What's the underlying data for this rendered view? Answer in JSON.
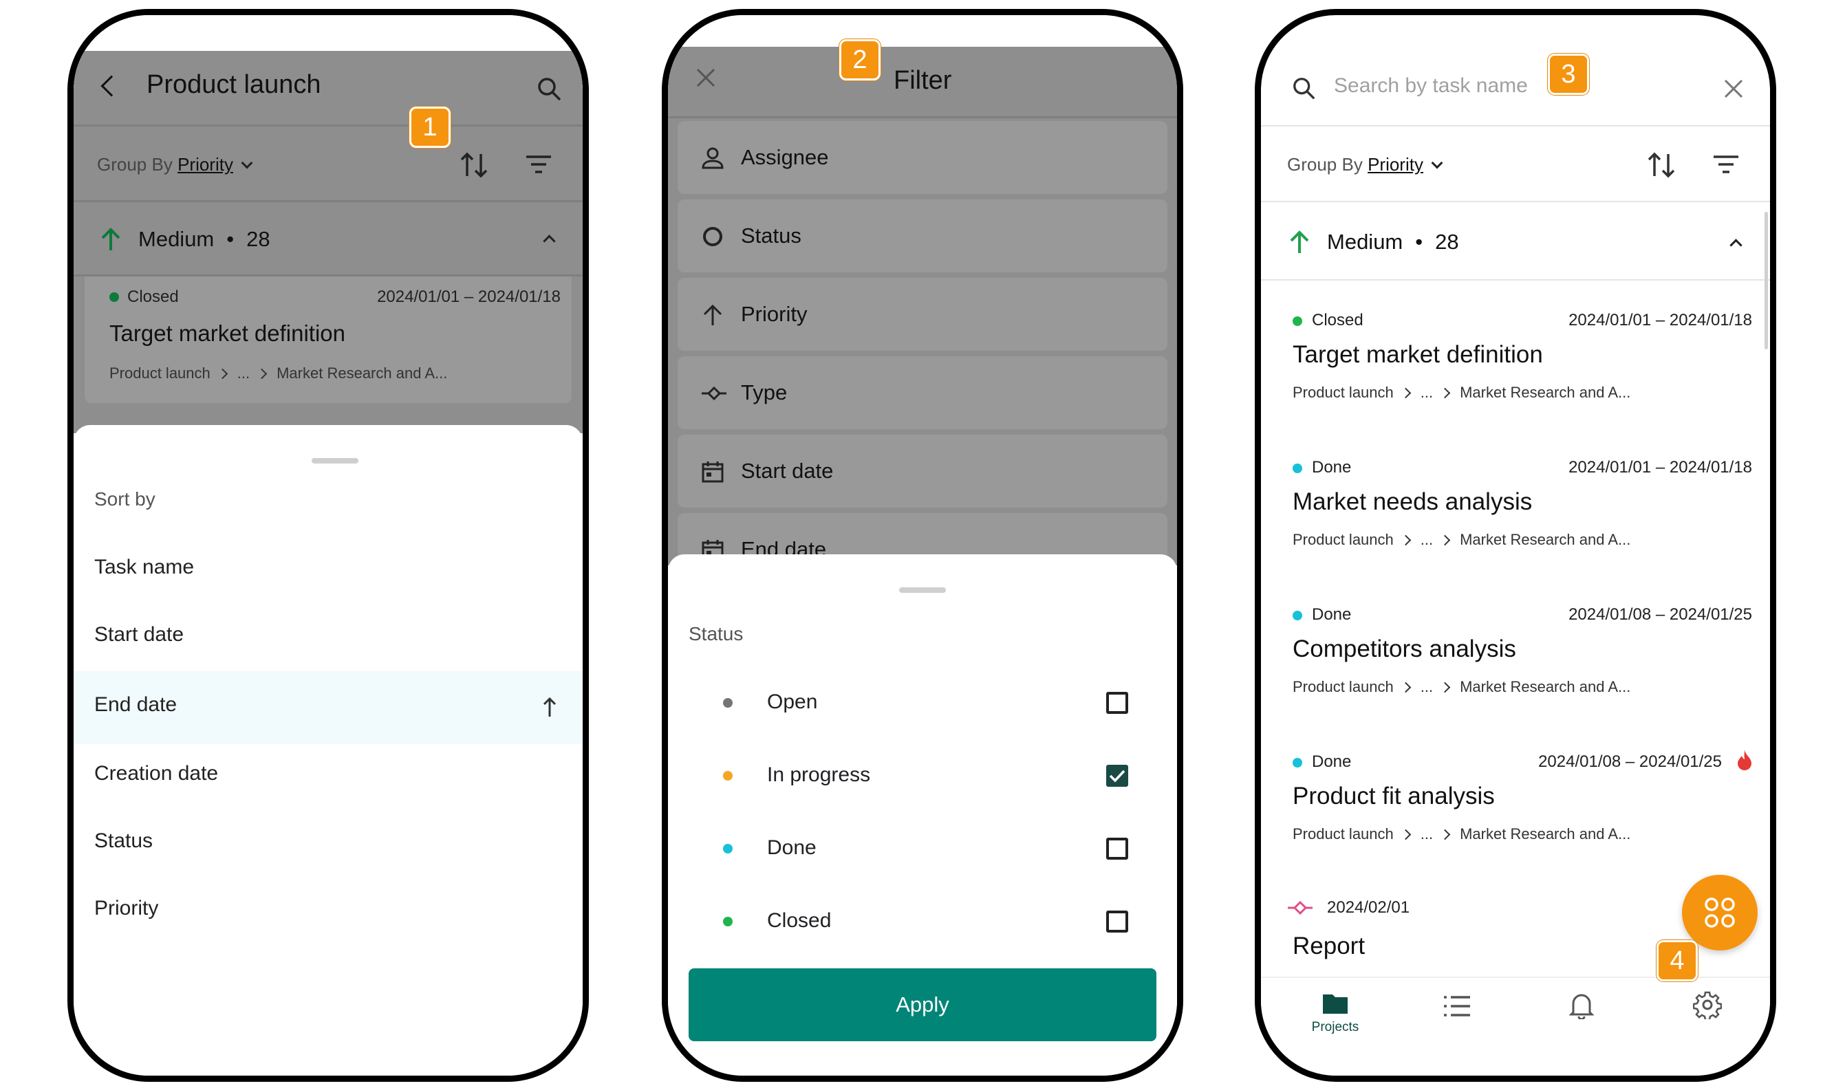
{
  "badges": [
    "1",
    "2",
    "3",
    "4"
  ],
  "screen1": {
    "title": "Product launch",
    "group_by_prefix": "Group By",
    "group_by_value": "Priority",
    "group": {
      "name": "Medium",
      "separator": "•",
      "count": "28"
    },
    "card": {
      "status": "Closed",
      "dates": "2024/01/01 – 2024/01/18",
      "title": "Target market definition",
      "breadcrumb": [
        "Product launch",
        "...",
        "Market Research and A..."
      ]
    },
    "sheet": {
      "heading": "Sort by",
      "options": [
        "Task name",
        "Start date",
        "End date",
        "Creation date",
        "Status",
        "Priority"
      ],
      "selected_index": 2,
      "selected_direction": "up-arrow-icon"
    }
  },
  "screen2": {
    "title": "Filter",
    "filters": [
      "Assignee",
      "Status",
      "Priority",
      "Type",
      "Start date",
      "End date"
    ],
    "sheet": {
      "heading": "Status",
      "options": [
        {
          "label": "Open",
          "color": "#757575",
          "checked": false
        },
        {
          "label": "In progress",
          "color": "#f5a623",
          "checked": true
        },
        {
          "label": "Done",
          "color": "#16c1d9",
          "checked": false
        },
        {
          "label": "Closed",
          "color": "#20b54a",
          "checked": false
        }
      ],
      "apply_label": "Apply"
    }
  },
  "screen3": {
    "search_placeholder": "Search by task name",
    "group_by_prefix": "Group By",
    "group_by_value": "Priority",
    "group": {
      "name": "Medium",
      "separator": "•",
      "count": "28"
    },
    "tasks": [
      {
        "status": "Closed",
        "status_color": "#20b54a",
        "dates": "2024/01/01 – 2024/01/18",
        "title": "Target market definition",
        "breadcrumb": [
          "Product launch",
          "...",
          "Market Research and A..."
        ]
      },
      {
        "status": "Done",
        "status_color": "#16c1d9",
        "dates": "2024/01/01 – 2024/01/18",
        "title": "Market needs analysis",
        "breadcrumb": [
          "Product launch",
          "...",
          "Market Research and A..."
        ]
      },
      {
        "status": "Done",
        "status_color": "#16c1d9",
        "dates": "2024/01/08 – 2024/01/25",
        "title": "Competitors analysis",
        "breadcrumb": [
          "Product launch",
          "...",
          "Market Research and A..."
        ]
      },
      {
        "status": "Done",
        "status_color": "#16c1d9",
        "dates": "2024/01/08 – 2024/01/25",
        "title": "Product fit analysis",
        "breadcrumb": [
          "Product launch",
          "...",
          "Market Research and A..."
        ],
        "flag": "fire-icon"
      }
    ],
    "milestone": {
      "date": "2024/02/01",
      "title": "Report"
    },
    "nav": [
      {
        "label": "Projects",
        "icon": "folder-icon",
        "active": true
      },
      {
        "label": "",
        "icon": "list-icon",
        "active": false
      },
      {
        "label": "",
        "icon": "bell-icon",
        "active": false
      },
      {
        "label": "",
        "icon": "gear-icon",
        "active": false
      }
    ]
  },
  "colors": {
    "accent": "#008577",
    "badge": "#f5940f",
    "overlay": "#8e8e8e",
    "priority_green": "#20a050"
  }
}
